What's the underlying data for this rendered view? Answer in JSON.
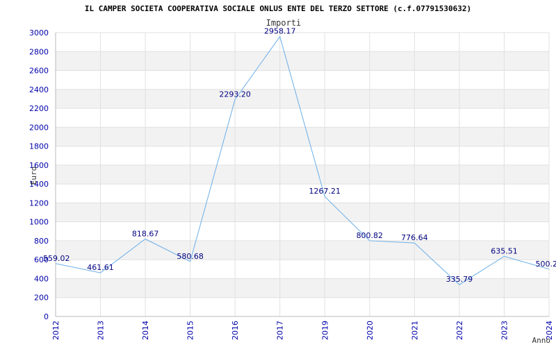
{
  "page": {
    "title": "IL CAMPER SOCIETA COOPERATIVA SOCIALE ONLUS ENTE DEL TERZO SETTORE (c.f.07791530632)"
  },
  "chart_data": {
    "type": "line",
    "title": "Importi",
    "xlabel": "Anno",
    "ylabel": "Euro",
    "categories": [
      "2012",
      "2013",
      "2014",
      "2015",
      "2016",
      "2017",
      "2019",
      "2020",
      "2021",
      "2022",
      "2023",
      "2024"
    ],
    "values": [
      559.02,
      461.61,
      818.67,
      580.68,
      2293.2,
      2958.17,
      1267.21,
      800.82,
      776.64,
      335.79,
      635.51,
      500.2
    ],
    "data_labels": [
      "559.02",
      "461.61",
      "818.67",
      "580.68",
      "2293.20",
      "2958.17",
      "1267.21",
      "800.82",
      "776.64",
      "335.79",
      "635.51",
      "500.2"
    ],
    "ylim": [
      0,
      3000
    ],
    "yticks": [
      0,
      200,
      400,
      600,
      800,
      1000,
      1200,
      1400,
      1600,
      1800,
      2000,
      2200,
      2400,
      2600,
      2800,
      3000
    ],
    "grid": true,
    "line_color": "#6aaee8",
    "band_color": "#f2f2f2",
    "tick_color": "#0000aa",
    "label_color": "#000080"
  }
}
